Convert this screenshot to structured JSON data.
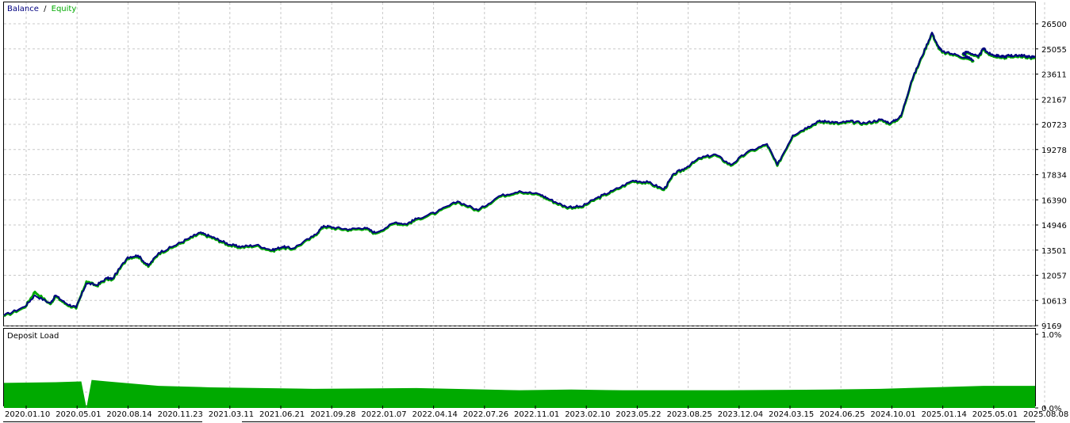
{
  "legend": {
    "balance_label": "Balance",
    "separator": "/",
    "equity_label": "Equity"
  },
  "lower_panel": {
    "title": "Deposit Load"
  },
  "colors": {
    "balance": "#000080",
    "equity": "#00aa00",
    "grid": "#c8c8c8",
    "deposit_fill": "#00aa00",
    "background": "#ffffff"
  },
  "chart_data": [
    {
      "type": "line",
      "title": "",
      "grid": true,
      "legend": "top-left",
      "y_ticks": [
        "26500",
        "25055",
        "23611",
        "22167",
        "20723",
        "19278",
        "17834",
        "16390",
        "14946",
        "13501",
        "12057",
        "10613",
        "9169"
      ],
      "ylim": [
        9169,
        26500
      ],
      "x_ticks": [
        "2020.01.10",
        "2020.05.01",
        "2020.08.14",
        "2020.11.23",
        "2021.03.11",
        "2021.06.21",
        "2021.09.28",
        "2022.01.07",
        "2022.04.14",
        "2022.07.26",
        "2022.11.01",
        "2023.02.10",
        "2023.05.22",
        "2023.08.25",
        "2023.12.04",
        "2024.03.15",
        "2024.06.25",
        "2024.10.01",
        "2025.01.14",
        "2025.05.01",
        "2025.08.08"
      ],
      "x": [
        0,
        0.02,
        0.03,
        0.045,
        0.05,
        0.06,
        0.07,
        0.08,
        0.09,
        0.1,
        0.105,
        0.12,
        0.13,
        0.14,
        0.15,
        0.165,
        0.18,
        0.19,
        0.2,
        0.21,
        0.22,
        0.23,
        0.245,
        0.26,
        0.27,
        0.28,
        0.3,
        0.31,
        0.32,
        0.335,
        0.35,
        0.36,
        0.38,
        0.39,
        0.4,
        0.42,
        0.44,
        0.46,
        0.48,
        0.5,
        0.52,
        0.53,
        0.545,
        0.56,
        0.575,
        0.59,
        0.61,
        0.625,
        0.64,
        0.65,
        0.66,
        0.675,
        0.69,
        0.705,
        0.72,
        0.74,
        0.75,
        0.765,
        0.78,
        0.79,
        0.8,
        0.81,
        0.82,
        0.835,
        0.85,
        0.86,
        0.87,
        0.88,
        0.89,
        0.9,
        0.905,
        0.91,
        0.925,
        0.94,
        0.93,
        0.935,
        0.945,
        0.95,
        0.955,
        0.96,
        0.965,
        0.97,
        0.975,
        0.98,
        0.985,
        0.99,
        0.995,
        1.0
      ],
      "series": [
        {
          "name": "Balance",
          "values": [
            9750,
            10250,
            10900,
            10450,
            10900,
            10450,
            10200,
            11600,
            11500,
            11900,
            11850,
            13100,
            13200,
            12600,
            13350,
            13750,
            14200,
            14500,
            14300,
            14050,
            13800,
            13700,
            13800,
            13500,
            13700,
            13600,
            14300,
            14900,
            14800,
            14700,
            14800,
            14500,
            15100,
            15000,
            15300,
            15700,
            16300,
            15800,
            16600,
            16900,
            16700,
            16400,
            16000,
            16000,
            16500,
            16900,
            17500,
            17400,
            17000,
            17900,
            18200,
            18800,
            19000,
            18400,
            19100,
            19600,
            18400,
            20100,
            20600,
            20900,
            20900,
            20800,
            20900,
            20800,
            21000,
            20800,
            21200,
            23200,
            24600,
            26000,
            25300,
            24900,
            24700,
            24400,
            24800,
            24900,
            24600,
            25100,
            24800,
            24700,
            24650,
            24600,
            24700,
            24650,
            24700,
            24650,
            24600,
            24600
          ]
        },
        {
          "name": "Equity",
          "values": [
            9700,
            10200,
            11100,
            10400,
            10850,
            10400,
            10150,
            11700,
            11450,
            11850,
            11800,
            13050,
            13150,
            12550,
            13300,
            13700,
            14150,
            14450,
            14250,
            14000,
            13750,
            13650,
            13750,
            13450,
            13650,
            13550,
            14250,
            14850,
            14750,
            14650,
            14750,
            14450,
            15050,
            14950,
            15250,
            15650,
            16250,
            15750,
            16550,
            16850,
            16650,
            16350,
            15950,
            15950,
            16450,
            16850,
            17450,
            17350,
            16950,
            17850,
            18150,
            18750,
            18950,
            18350,
            19050,
            19550,
            18350,
            20050,
            20550,
            20850,
            20850,
            20750,
            20850,
            20750,
            20950,
            20750,
            21150,
            23150,
            24550,
            25950,
            25250,
            24850,
            24650,
            24350,
            24750,
            24850,
            24550,
            25050,
            24750,
            24650,
            24600,
            24550,
            24650,
            24600,
            24650,
            24600,
            24550,
            24550
          ]
        }
      ]
    },
    {
      "type": "area",
      "title": "Deposit Load",
      "y_ticks": [
        "1.0%",
        "0.0%"
      ],
      "ylim": [
        0,
        1.0
      ],
      "x": [
        0,
        0.05,
        0.075,
        0.08,
        0.085,
        0.1,
        0.15,
        0.2,
        0.3,
        0.4,
        0.5,
        0.55,
        0.6,
        0.7,
        0.8,
        0.85,
        0.9,
        0.95,
        1.0
      ],
      "series": [
        {
          "name": "Deposit Load",
          "values": [
            0.34,
            0.35,
            0.36,
            0.0,
            0.38,
            0.36,
            0.3,
            0.28,
            0.26,
            0.27,
            0.24,
            0.25,
            0.24,
            0.24,
            0.25,
            0.26,
            0.28,
            0.3,
            0.3
          ]
        }
      ]
    }
  ]
}
